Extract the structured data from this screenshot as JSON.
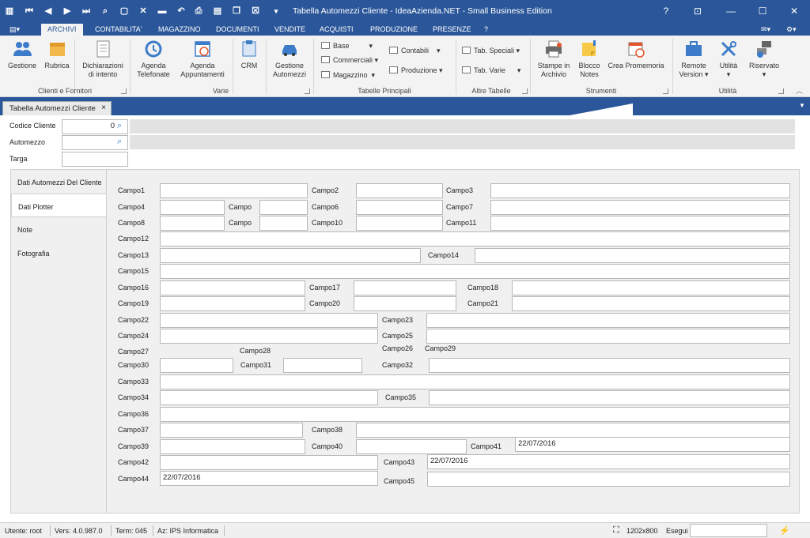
{
  "window": {
    "title": "Tabella Automezzi Cliente - IdeaAzienda.NET - Small Business Edition",
    "help": "?"
  },
  "menu": [
    "ARCHIVI",
    "CONTABILITA'",
    "MAGAZZINO",
    "DOCUMENTI",
    "VENDITE",
    "ACQUISTI",
    "PRODUZIONE",
    "PRESENZE",
    "?"
  ],
  "ribbon": {
    "gestione": "Gestione",
    "rubrica": "Rubrica",
    "dichiarazioni_1": "Dichiarazioni",
    "dichiarazioni_2": "di intento",
    "group_clienti": "Clienti e Fornitori",
    "agenda_tel_1": "Agenda",
    "agenda_tel_2": "Telefonate",
    "agenda_app_1": "Agenda",
    "agenda_app_2": "Appuntamenti",
    "crm": "CRM",
    "gestione_automezzi_1": "Gestione",
    "gestione_automezzi_2": "Automezzi",
    "group_varie": "Varie",
    "base": "Base",
    "commerciali": "Commerciali",
    "magazzino": "Magazzino",
    "contabili": "Contabili",
    "produzione": "Produzione",
    "group_tabelle": "Tabelle Principali",
    "tab_speciali": "Tab. Speciali",
    "tab_varie": "Tab. Varie",
    "group_altre": "Altre Tabelle",
    "stampe_1": "Stampe in",
    "stampe_2": "Archivio",
    "blocco_1": "Blocco",
    "blocco_2": "Notes",
    "promemoria": "Crea Promemoria",
    "group_strumenti": "Strumenti",
    "remote_1": "Remote",
    "remote_2": "Version",
    "utilita": "Utilità",
    "riservato": "Riservato",
    "group_utilita": "Utilità"
  },
  "doc_tab": {
    "label": "Tabella Automezzi Cliente",
    "close": "×"
  },
  "header_fields": {
    "codice_label": "Codice Cliente",
    "codice_value": "0",
    "automezzo_label": "Automezzo",
    "automezzo_value": "",
    "targa_label": "Targa",
    "targa_value": ""
  },
  "side_tabs": [
    "Dati Automezzi Del Cliente",
    "Dati Plotter",
    "Note",
    "Fotografia"
  ],
  "active_side_tab": "Dati Plotter",
  "fields": {
    "c1": "Campo1",
    "c2": "Campo2",
    "c3": "Campo3",
    "c4": "Campo4",
    "c5": "Campo",
    "c5b": "Campo",
    "c6": "Campo6",
    "c7": "Campo7",
    "c8": "Campo8",
    "c10": "Campo10",
    "c11": "Campo11",
    "c12": "Campo12",
    "c13": "Campo13",
    "c14": "Campo14",
    "c15": "Campo15",
    "c16": "Campo16",
    "c17": "Campo17",
    "c18": "Campo18",
    "c19": "Campo19",
    "c20": "Campo20",
    "c21": "Campo21",
    "c22": "Campo22",
    "c23": "Campo23",
    "c24": "Campo24",
    "c25": "Campo25",
    "c26": "Campo26",
    "c27": "Campo27",
    "c28": "Campo28",
    "c29": "Campo29",
    "c30": "Campo30",
    "c31": "Campo31",
    "c32": "Campo32",
    "c33": "Campo33",
    "c34": "Campo34",
    "c35": "Campo35",
    "c36": "Campo36",
    "c37": "Campo37",
    "c38": "Campo38",
    "c39": "Campo39",
    "c40": "Campo40",
    "c41": "Campo41",
    "c42": "Campo42",
    "c43": "Campo43",
    "c44": "Campo44",
    "c45": "Campo45"
  },
  "values": {
    "v41": "22/07/2016",
    "v43": "22/07/2016",
    "v44": "22/07/2016"
  },
  "status": {
    "utente": "Utente: root",
    "vers": "Vers: 4.0.987.0",
    "term": "Term: 045",
    "az": "Az: IPS Informatica",
    "resolution": "1202x800",
    "esegui": "Esegui"
  },
  "colors": {
    "accent": "#2b579a",
    "panel": "#f0f0f0"
  }
}
